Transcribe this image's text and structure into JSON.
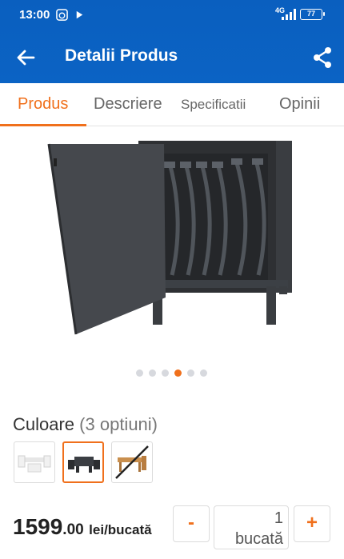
{
  "status_bar": {
    "time": "13:00",
    "network": "4G",
    "battery": "77"
  },
  "app_bar": {
    "title": "Detalii Produs",
    "back_icon": "arrow-left-icon",
    "share_icon": "share-icon"
  },
  "tabs": [
    {
      "label": "Produs",
      "active": true
    },
    {
      "label": "Descriere",
      "active": false
    },
    {
      "label": "Specificatii",
      "active": false
    },
    {
      "label": "Opinii",
      "active": false
    }
  ],
  "gallery": {
    "image_count": 6,
    "active_index": 4
  },
  "color_option": {
    "label": "Culoare",
    "count_text": "(3 optiuni)",
    "swatches": [
      {
        "name": "white-set",
        "selected": false,
        "available": true
      },
      {
        "name": "dark-grey-set",
        "selected": true,
        "available": true
      },
      {
        "name": "wood-set",
        "selected": false,
        "available": false
      }
    ]
  },
  "purchase": {
    "price_int": "1599",
    "price_dec": ".00",
    "price_unit": "lei/bucată",
    "minus_label": "-",
    "plus_label": "+",
    "quantity": "1",
    "quantity_unit": "bucată"
  },
  "colors": {
    "app_bar": "#0b63c4",
    "accent": "#f0701c"
  }
}
